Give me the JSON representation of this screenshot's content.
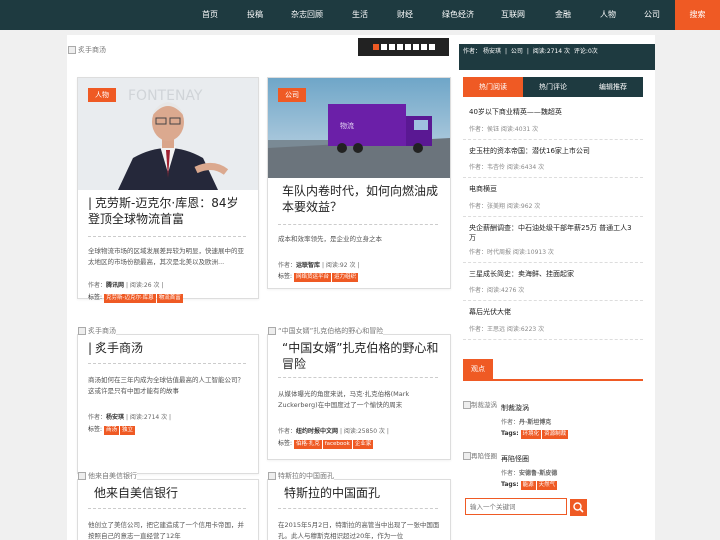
{
  "nav": {
    "items": [
      "首页",
      "投稿",
      "杂志回顾",
      "生活",
      "财经",
      "绿色经济",
      "互联网",
      "金融",
      "人物",
      "公司"
    ],
    "search_label": "搜索"
  },
  "banner": {
    "alt": "炙手商汤",
    "info": {
      "author_label": "作者：",
      "author": "杨安琪",
      "sep": "|",
      "source": "公司",
      "views": "阅读:2714 次",
      "comments": "评论:0次"
    }
  },
  "cards": [
    {
      "badge": "人物",
      "title": "克劳斯-迈克尔·库恩：84岁登顶全球物流首富",
      "desc": "全球物流市场的区域发展差异较为明显，快速展中的亚太地区的市场份额最高，其次是北美以及欧洲...",
      "author": "腾讯网",
      "views": "阅读:26 次",
      "tags": [
        "克劳斯-迈克尔·库恩",
        "物流首富"
      ]
    },
    {
      "badge": "公司",
      "title": "车队内卷时代，如何向燃油成本要效益？",
      "desc": "成本和效率领先，是企业的立身之本",
      "author": "运联智库",
      "views": "阅读:92 次",
      "tags": [
        "网络货运平台",
        "运力组织"
      ]
    },
    {
      "img_alt": "炙手商汤",
      "title": "炙手商汤",
      "desc": "商汤如何在三年内成为全球估值最高的人工智能公司？这或许是只有中国才能有的故事",
      "author": "杨安琪",
      "views": "阅读:2714 次",
      "tags": [
        "商汤",
        "独立"
      ]
    },
    {
      "img_alt": "“中国女婿”扎克伯格的野心和冒险",
      "title": "“中国女婿”扎克伯格的野心和冒险",
      "desc": "从媒体曝光的角度来说，马克·扎克伯格(Mark Zuckerberg)在中国度过了一个愉快的周末",
      "author": "纽约时报中文网",
      "views": "阅读:25850 次",
      "tags": [
        "伯格·扎克",
        "facebook",
        "企业家"
      ]
    },
    {
      "img_alt": "他来自美信银行",
      "title": "他来自美信银行",
      "desc": "他创立了美信公司，把它建造成了一个信用卡帝国，并按照自己的意志一直经营了12年"
    },
    {
      "img_alt": "特斯拉的中国面孔",
      "title": "特斯拉的中国面孔",
      "desc": "在2015年5月2日，特斯拉的高管当中出现了一张中国面孔。此人与穆斯克相识超过20年，作为一位"
    }
  ],
  "labels": {
    "author": "作者：",
    "tags": "标签:",
    "pipe": "|"
  },
  "sidebar": {
    "tabs": [
      "热门阅读",
      "热门评论",
      "编辑推荐"
    ],
    "hot": [
      {
        "title": "40岁以下商业精英——魏超英",
        "meta": "作者：侯钰 阅读:4031 次"
      },
      {
        "title": "史玉柱的资本帝国：潜伏16家上市公司",
        "meta": "作者：韦杏伶 阅读:6434 次"
      },
      {
        "title": "电商横亘",
        "meta": "作者：张美翔 阅读:962 次"
      },
      {
        "title": "央企薪酬调查：中石油处级干部年薪25万 普通工人3万",
        "meta": "作者：时代周报 阅读:10913 次"
      },
      {
        "title": "三星成长简史：卖海鲜、挂面起家",
        "meta": "作者：阅读:4276 次"
      },
      {
        "title": "幕后光伏大佬",
        "meta": "作者：王思远 阅读:6223 次"
      }
    ],
    "view_label": "观点",
    "views": [
      {
        "alt": "制裁漩涡",
        "title": "制裁漩涡",
        "author": "丹·斯坦博克",
        "tags_label": "Tags:",
        "tags": [
          "环境化",
          "资源制裁"
        ]
      },
      {
        "alt": "再陷怪圈",
        "title": "再陷怪圈",
        "author": "安德鲁·斯皮德",
        "tags_label": "Tags:",
        "tags": [
          "能源",
          "天然气"
        ]
      }
    ],
    "search_placeholder": "输入一个关键词"
  }
}
